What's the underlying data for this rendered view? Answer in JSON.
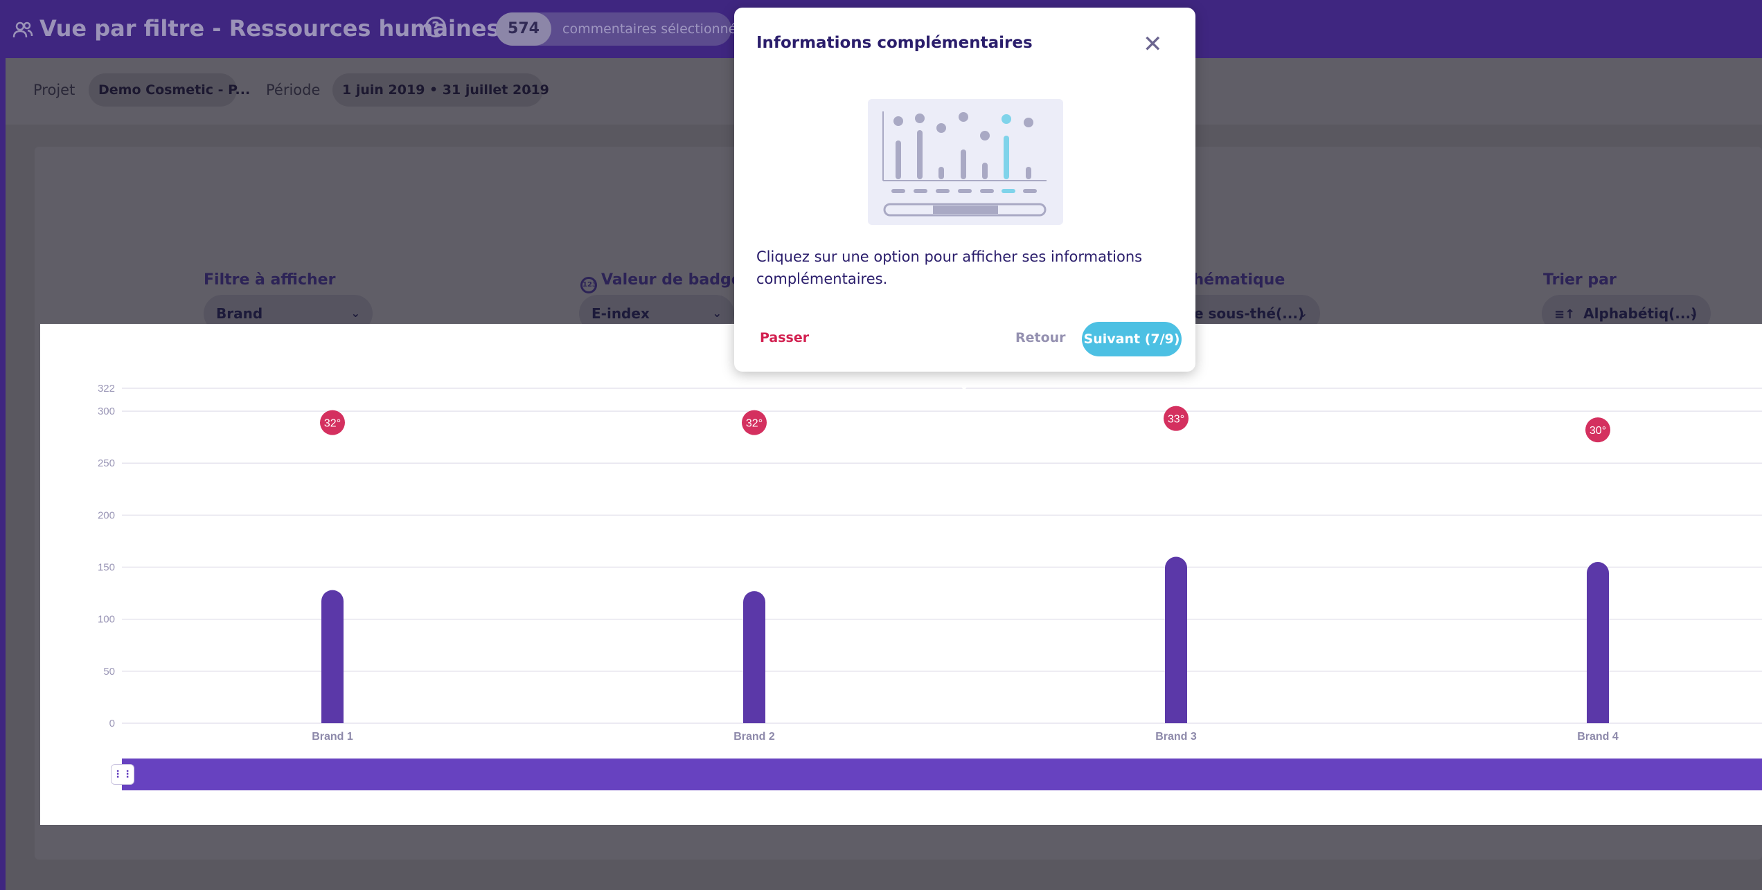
{
  "header": {
    "title": "Vue par filtre - Ressources humaines",
    "help_icon": "?",
    "selected_count": "574",
    "selected_label": "commentaires sélectionnés"
  },
  "filters": {
    "project_label": "Projet",
    "project_value": "Demo Cosmetic - P...",
    "period_label": "Période",
    "period_value": "1 juin 2019 • 31 juillet 2019"
  },
  "controls": {
    "filter_label": "Filtre à afficher",
    "filter_value": "Brand",
    "badge_label": "Valeur de badge",
    "badge_value": "E-index",
    "thematic_label": "thématique",
    "thematic_value": "e sous-thé(...)",
    "sort_label": "Trier par",
    "sort_value": "Alphabétiq(...)"
  },
  "modal": {
    "title": "Informations complémentaires",
    "close_icon": "close-icon",
    "body": "Cliquez sur une option pour afficher ses informations complémentaires.",
    "skip_label": "Passer",
    "back_label": "Retour",
    "next_label": "Suivant (7/9)"
  },
  "colors": {
    "header_bg": "#3f2680",
    "bar": "#5b38a8",
    "badge": "#d4305f",
    "accent": "#4cc0e3",
    "scrollbar": "#6742c0"
  },
  "chart_data": {
    "type": "bar",
    "categories": [
      "Brand 1",
      "Brand 2",
      "Brand 3",
      "Brand 4"
    ],
    "values": [
      128,
      127,
      160,
      155
    ],
    "badges": [
      "32°",
      "32°",
      "33°",
      "30°"
    ],
    "badge_values": [
      289,
      289,
      293,
      282
    ],
    "yticks": [
      "0",
      "50",
      "100",
      "150",
      "200",
      "250",
      "300",
      "322"
    ],
    "ylim": [
      0,
      322
    ],
    "grid": true
  }
}
